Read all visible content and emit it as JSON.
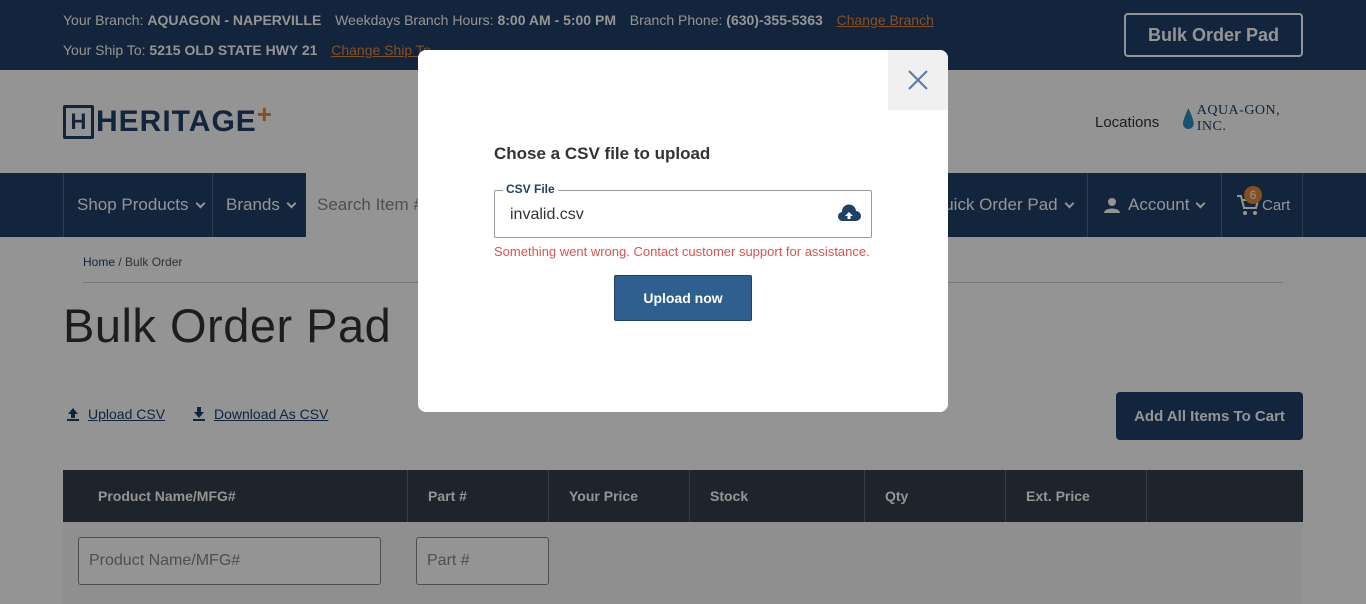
{
  "topbar": {
    "branch_label": "Your Branch:",
    "branch_name": "AQUAGON - NAPERVILLE",
    "hours_label": "Weekdays Branch Hours:",
    "hours_value": "8:00 AM - 5:00 PM",
    "phone_label": "Branch Phone:",
    "phone_value": "(630)-355-5363",
    "change_branch": "Change Branch",
    "ship_label": "Your Ship To:",
    "ship_value": "5215 OLD STATE HWY 21",
    "change_ship": "Change Ship To",
    "bulk_order_button": "Bulk Order Pad"
  },
  "header": {
    "logo_letter": "H",
    "logo_text": "HERITAGE",
    "logo_plus": "+",
    "locations": "Locations",
    "partner_logo": "AQUA-GON, INC."
  },
  "nav": {
    "shop_products": "Shop Products",
    "brands": "Brands",
    "search_placeholder": "Search Item #",
    "quick_order": "Quick Order Pad",
    "account": "Account",
    "cart": "Cart",
    "cart_count": "6"
  },
  "breadcrumb": {
    "home": "Home",
    "separator": "/",
    "current": "Bulk Order"
  },
  "page": {
    "title": "Bulk Order Pad",
    "upload_csv": "Upload CSV",
    "download_csv": "Download As CSV",
    "add_all": "Add All Items To Cart"
  },
  "table": {
    "columns": [
      "Product Name/MFG#",
      "Part #",
      "Your Price",
      "Stock",
      "Qty",
      "Ext. Price",
      ""
    ],
    "product_placeholder": "Product Name/MFG#",
    "part_placeholder": "Part #"
  },
  "modal": {
    "title": "Chose a CSV file to upload",
    "field_label": "CSV File",
    "field_value": "invalid.csv",
    "error": "Something went wrong. Contact customer support for assistance.",
    "upload_button": "Upload now"
  },
  "colors": {
    "brand_navy": "#1f4068",
    "accent_orange": "#e8893a",
    "error_red": "#d9534f"
  }
}
